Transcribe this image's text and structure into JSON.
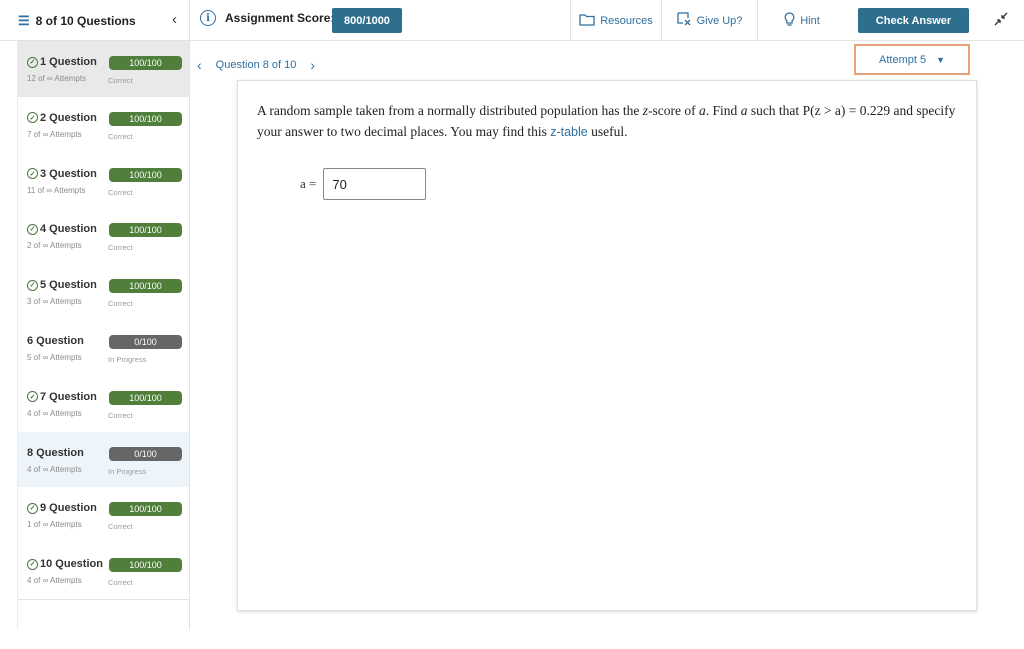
{
  "header": {
    "toc_label": "8 of 10 Questions",
    "score_label": "Assignment Score:",
    "score_value": "800/1000",
    "resources": "Resources",
    "give_up": "Give Up?",
    "hint": "Hint",
    "check_answer": "Check Answer"
  },
  "nav": {
    "label": "Question 8 of 10",
    "attempt": "Attempt 5"
  },
  "questions": [
    {
      "title": "1 Question",
      "attempts": "12 of ∞ Attempts",
      "score": "100/100",
      "status": "Correct",
      "done": true
    },
    {
      "title": "2 Question",
      "attempts": "7 of ∞ Attempts",
      "score": "100/100",
      "status": "Correct",
      "done": true
    },
    {
      "title": "3 Question",
      "attempts": "11 of ∞ Attempts",
      "score": "100/100",
      "status": "Correct",
      "done": true
    },
    {
      "title": "4 Question",
      "attempts": "2 of ∞ Attempts",
      "score": "100/100",
      "status": "Correct",
      "done": true
    },
    {
      "title": "5 Question",
      "attempts": "3 of ∞ Attempts",
      "score": "100/100",
      "status": "Correct",
      "done": true
    },
    {
      "title": "6 Question",
      "attempts": "5 of ∞ Attempts",
      "score": "0/100",
      "status": "In Progress",
      "done": false
    },
    {
      "title": "7 Question",
      "attempts": "4 of ∞ Attempts",
      "score": "100/100",
      "status": "Correct",
      "done": true
    },
    {
      "title": "8 Question",
      "attempts": "4 of ∞ Attempts",
      "score": "0/100",
      "status": "In Progress",
      "done": false
    },
    {
      "title": "9 Question",
      "attempts": "1 of ∞ Attempts",
      "score": "100/100",
      "status": "Correct",
      "done": true
    },
    {
      "title": "10 Question",
      "attempts": "4 of ∞ Attempts",
      "score": "100/100",
      "status": "Correct",
      "done": true
    }
  ],
  "question": {
    "text_part1": "A random sample taken from a normally distributed population has the ",
    "z_word": "z",
    "text_part2": "-score of ",
    "a1": "a",
    "text_part3": ". Find ",
    "a2": "a",
    "text_part4": " such that ",
    "prob_expr": "P(z > a) = 0.229",
    "text_line2": " and specify your answer to two decimal places. You may find this ",
    "link": "z-table",
    "text_end": " useful.",
    "answer_label": "a =",
    "answer_value": "70"
  },
  "colors": {
    "accent": "#2e6f8e",
    "correct_badge": "#4f7f3a",
    "progress_badge": "#666666",
    "attempt_border": "#e8a27a"
  }
}
